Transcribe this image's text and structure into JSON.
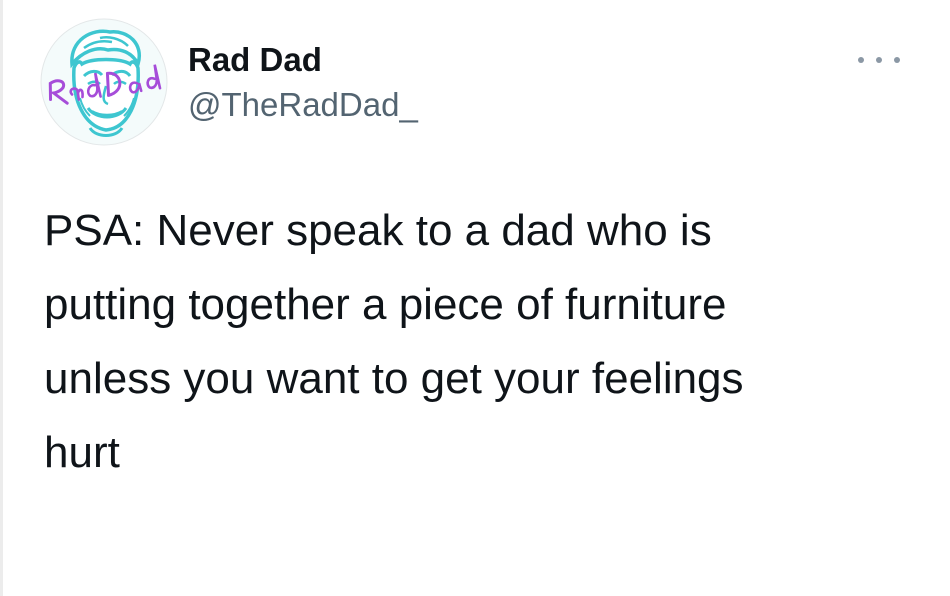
{
  "tweet": {
    "author": {
      "display_name": "Rad Dad",
      "handle": "@TheRadDad_",
      "avatar": {
        "logo_text": "Rad Dad",
        "logo_color": "#a64dd9",
        "outline_color": "#3ec6d0",
        "icon": "dad-face-logo"
      }
    },
    "more_icon": "ellipsis-icon",
    "text": "PSA: Never speak to a dad who is\nputting together a piece of furniture\nunless you want to get your feelings\nhurt"
  },
  "colors": {
    "name": "#0f1419",
    "handle": "#536471",
    "text": "#0f1419",
    "dots": "#8b98a5"
  }
}
